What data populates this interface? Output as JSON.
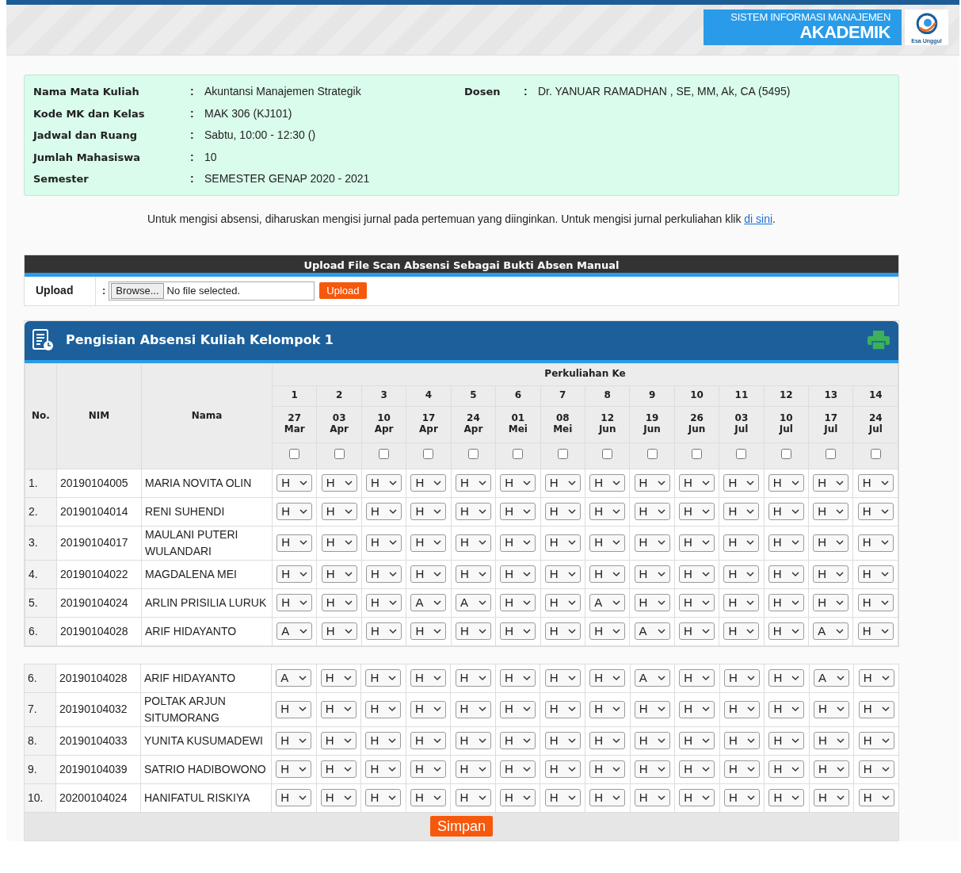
{
  "header": {
    "system_line": "SISTEM INFORMASI MANAJEMEN",
    "system_name": "AKADEMIK",
    "logo_caption": "Esa Unggul"
  },
  "course_info": {
    "fields": [
      {
        "label": "Nama Mata Kuliah",
        "separator": ":",
        "value": "Akuntansi Manajemen Strategik"
      },
      {
        "label": "Kode MK dan Kelas",
        "separator": ":",
        "value": "MAK 306 (KJ101)"
      },
      {
        "label": "Jadwal dan Ruang",
        "separator": ":",
        "value": "Sabtu, 10:00 - 12:30 ()"
      },
      {
        "label": "Jumlah Mahasiswa",
        "separator": ":",
        "value": "10"
      },
      {
        "label": "Semester",
        "separator": ":",
        "value": "SEMESTER GENAP 2020 - 2021"
      }
    ],
    "lecturer": {
      "label": "Dosen",
      "separator": ":",
      "value": "Dr. YANUAR RAMADHAN , SE, MM, Ak, CA (5495)"
    }
  },
  "note": {
    "text": "Untuk mengisi absensi, diharuskan mengisi jurnal pada pertemuan yang diinginkan. Untuk mengisi jurnal perkuliahan klik",
    "link": "di sini",
    "end": "."
  },
  "upload_panel": {
    "title": "Upload File Scan Absensi Sebagai Bukti Absen Manual",
    "label": "Upload",
    "separator": ":",
    "browse_button": "Browse...",
    "file_status": "No file selected.",
    "upload_button": "Upload"
  },
  "attendance": {
    "title": "Pengisian Absensi Kuliah Kelompok 1",
    "columns": {
      "no": "No.",
      "nim": "NIM",
      "name": "Nama",
      "meetings_group": "Perkuliahan Ke"
    },
    "meetings": [
      {
        "number": "1",
        "day": "27",
        "month": "Mar",
        "checked": false
      },
      {
        "number": "2",
        "day": "03",
        "month": "Apr",
        "checked": false
      },
      {
        "number": "3",
        "day": "10",
        "month": "Apr",
        "checked": false
      },
      {
        "number": "4",
        "day": "17",
        "month": "Apr",
        "checked": false
      },
      {
        "number": "5",
        "day": "24",
        "month": "Apr",
        "checked": false
      },
      {
        "number": "6",
        "day": "01",
        "month": "Mei",
        "checked": false
      },
      {
        "number": "7",
        "day": "08",
        "month": "Mei",
        "checked": false
      },
      {
        "number": "8",
        "day": "12",
        "month": "Jun",
        "checked": false
      },
      {
        "number": "9",
        "day": "19",
        "month": "Jun",
        "checked": false
      },
      {
        "number": "10",
        "day": "26",
        "month": "Jun",
        "checked": false
      },
      {
        "number": "11",
        "day": "03",
        "month": "Jul",
        "checked": false
      },
      {
        "number": "12",
        "day": "10",
        "month": "Jul",
        "checked": false
      },
      {
        "number": "13",
        "day": "17",
        "month": "Jul",
        "checked": false
      },
      {
        "number": "14",
        "day": "24",
        "month": "Jul",
        "checked": false
      }
    ],
    "rows": [
      {
        "no": "1.",
        "nim": "20190104005",
        "name": "MARIA NOVITA OLIN",
        "marks": [
          "H",
          "H",
          "H",
          "H",
          "H",
          "H",
          "H",
          "H",
          "H",
          "H",
          "H",
          "H",
          "H",
          "H"
        ]
      },
      {
        "no": "2.",
        "nim": "20190104014",
        "name": "RENI SUHENDI",
        "marks": [
          "H",
          "H",
          "H",
          "H",
          "H",
          "H",
          "H",
          "H",
          "H",
          "H",
          "H",
          "H",
          "H",
          "H"
        ]
      },
      {
        "no": "3.",
        "nim": "20190104017",
        "name": "MAULANI PUTERI WULANDARI",
        "marks": [
          "H",
          "H",
          "H",
          "H",
          "H",
          "H",
          "H",
          "H",
          "H",
          "H",
          "H",
          "H",
          "H",
          "H"
        ]
      },
      {
        "no": "4.",
        "nim": "20190104022",
        "name": "MAGDALENA MEI",
        "marks": [
          "H",
          "H",
          "H",
          "H",
          "H",
          "H",
          "H",
          "H",
          "H",
          "H",
          "H",
          "H",
          "H",
          "H"
        ]
      },
      {
        "no": "5.",
        "nim": "20190104024",
        "name": "ARLIN PRISILIA LURUK",
        "marks": [
          "H",
          "H",
          "H",
          "A",
          "A",
          "H",
          "H",
          "A",
          "H",
          "H",
          "H",
          "H",
          "H",
          "H"
        ]
      },
      {
        "no": "6.",
        "nim": "20190104028",
        "name": "ARIF HIDAYANTO",
        "marks": [
          "A",
          "H",
          "H",
          "H",
          "H",
          "H",
          "H",
          "H",
          "A",
          "H",
          "H",
          "H",
          "A",
          "H"
        ]
      }
    ],
    "rows_continued": [
      {
        "no": "6.",
        "nim": "20190104028",
        "name": "ARIF HIDAYANTO",
        "marks": [
          "A",
          "H",
          "H",
          "H",
          "H",
          "H",
          "H",
          "H",
          "A",
          "H",
          "H",
          "H",
          "A",
          "H"
        ]
      },
      {
        "no": "7.",
        "nim": "20190104032",
        "name": "POLTAK ARJUN SITUMORANG",
        "marks": [
          "H",
          "H",
          "H",
          "H",
          "H",
          "H",
          "H",
          "H",
          "H",
          "H",
          "H",
          "H",
          "H",
          "H"
        ]
      },
      {
        "no": "8.",
        "nim": "20190104033",
        "name": "YUNITA KUSUMADEWI",
        "marks": [
          "H",
          "H",
          "H",
          "H",
          "H",
          "H",
          "H",
          "H",
          "H",
          "H",
          "H",
          "H",
          "H",
          "H"
        ]
      },
      {
        "no": "9.",
        "nim": "20190104039",
        "name": "SATRIO HADIBOWONO",
        "marks": [
          "H",
          "H",
          "H",
          "H",
          "H",
          "H",
          "H",
          "H",
          "H",
          "H",
          "H",
          "H",
          "H",
          "H"
        ]
      },
      {
        "no": "10.",
        "nim": "20200104024",
        "name": "HANIFATUL RISKIYA",
        "marks": [
          "H",
          "H",
          "H",
          "H",
          "H",
          "H",
          "H",
          "H",
          "H",
          "H",
          "H",
          "H",
          "H",
          "H"
        ]
      }
    ],
    "save_button": "Simpan"
  }
}
